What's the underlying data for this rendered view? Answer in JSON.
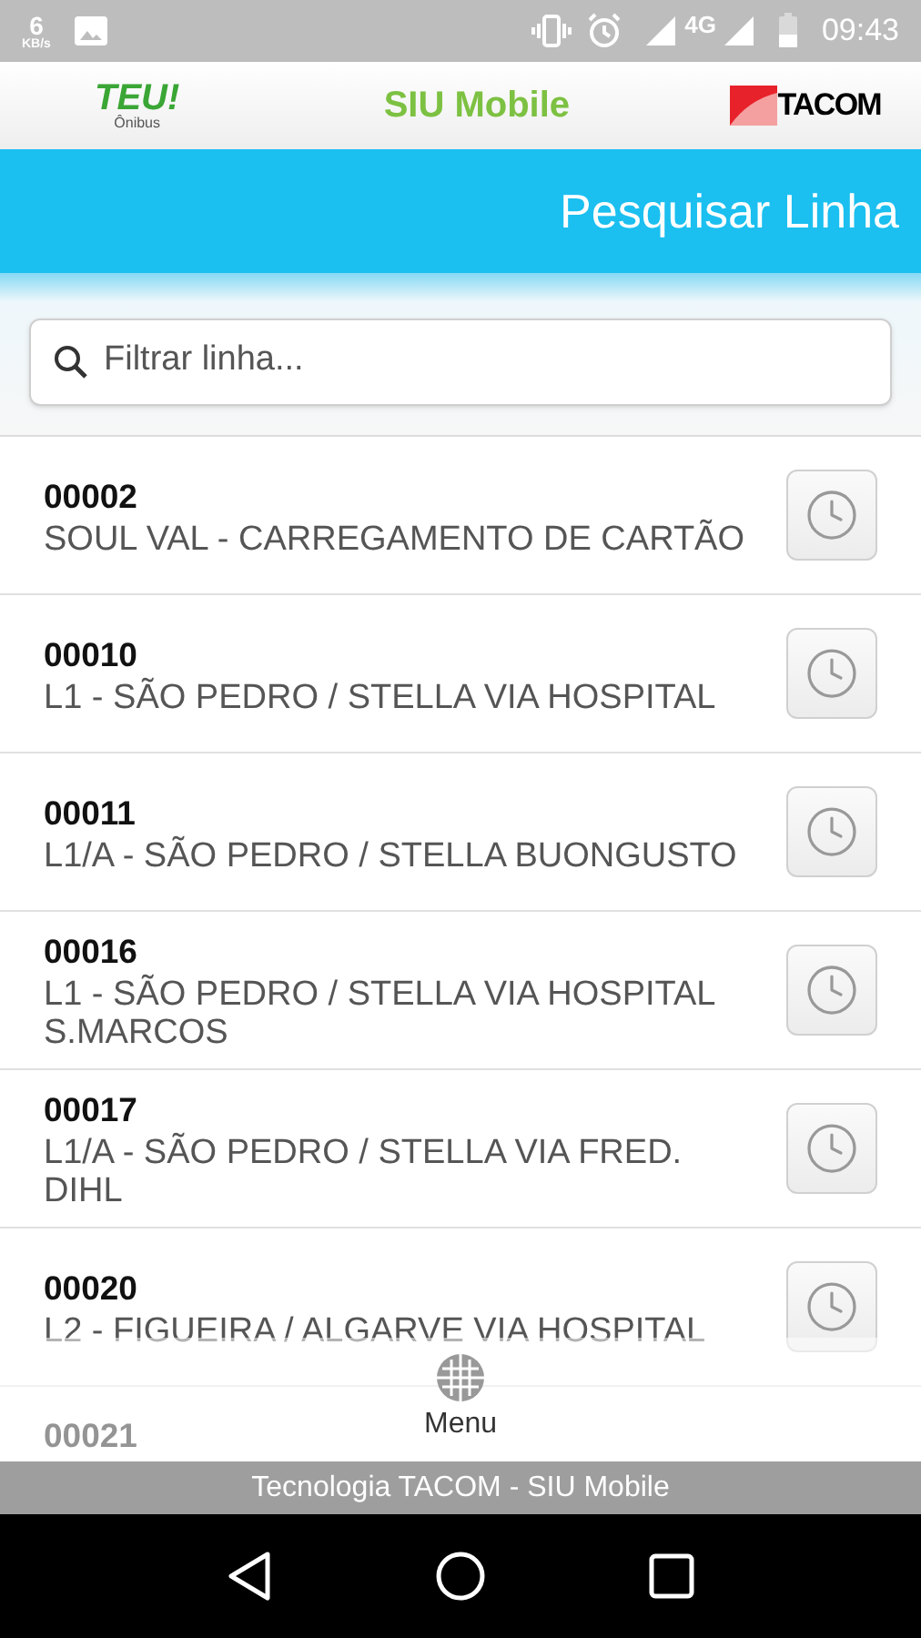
{
  "status_bar": {
    "speed": "6",
    "speed_unit": "KB/s",
    "network": "4G",
    "time": "09:43"
  },
  "header": {
    "left_logo": {
      "word": "TEU!",
      "caption": "Ônibus"
    },
    "title": "SIU Mobile",
    "right_logo": {
      "word": "TACOM"
    }
  },
  "page_title": "Pesquisar Linha",
  "search": {
    "placeholder": "Filtrar linha..."
  },
  "lines": [
    {
      "code": "00002",
      "name": "SOUL VAL - CARREGAMENTO DE CARTÃO"
    },
    {
      "code": "00010",
      "name": "L1 - SÃO PEDRO / STELLA VIA HOSPITAL"
    },
    {
      "code": "00011",
      "name": "L1/A - SÃO PEDRO / STELLA BUONGUSTO"
    },
    {
      "code": "00016",
      "name": "L1 - SÃO PEDRO / STELLA VIA HOSPITAL S.MARCOS"
    },
    {
      "code": "00017",
      "name": "L1/A - SÃO PEDRO / STELLA VIA FRED. DIHL"
    },
    {
      "code": "00020",
      "name": "L2 - FIGUEIRA / ALGARVE VIA HOSPITAL"
    },
    {
      "code": "00021"
    }
  ],
  "menu": {
    "label": "Menu"
  },
  "footer": "Tecnologia TACOM - SIU Mobile"
}
